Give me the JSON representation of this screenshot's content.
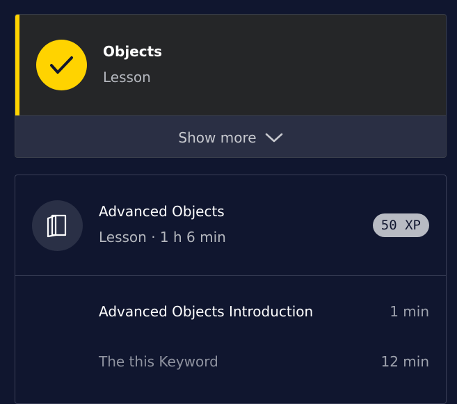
{
  "completed": {
    "title": "Objects",
    "subtitle": "Lesson",
    "show_more": "Show more",
    "accent": "#ffd300"
  },
  "module": {
    "title": "Advanced Objects",
    "subtitle": "Lesson · 1 h 6 min",
    "xp": "50 XP",
    "items": [
      {
        "name": "Advanced Objects Introduction",
        "duration": "1 min"
      },
      {
        "name": "The this Keyword",
        "duration": "12 min"
      }
    ]
  },
  "icons": [
    "check-icon",
    "chevron-down-icon",
    "book-icon"
  ]
}
